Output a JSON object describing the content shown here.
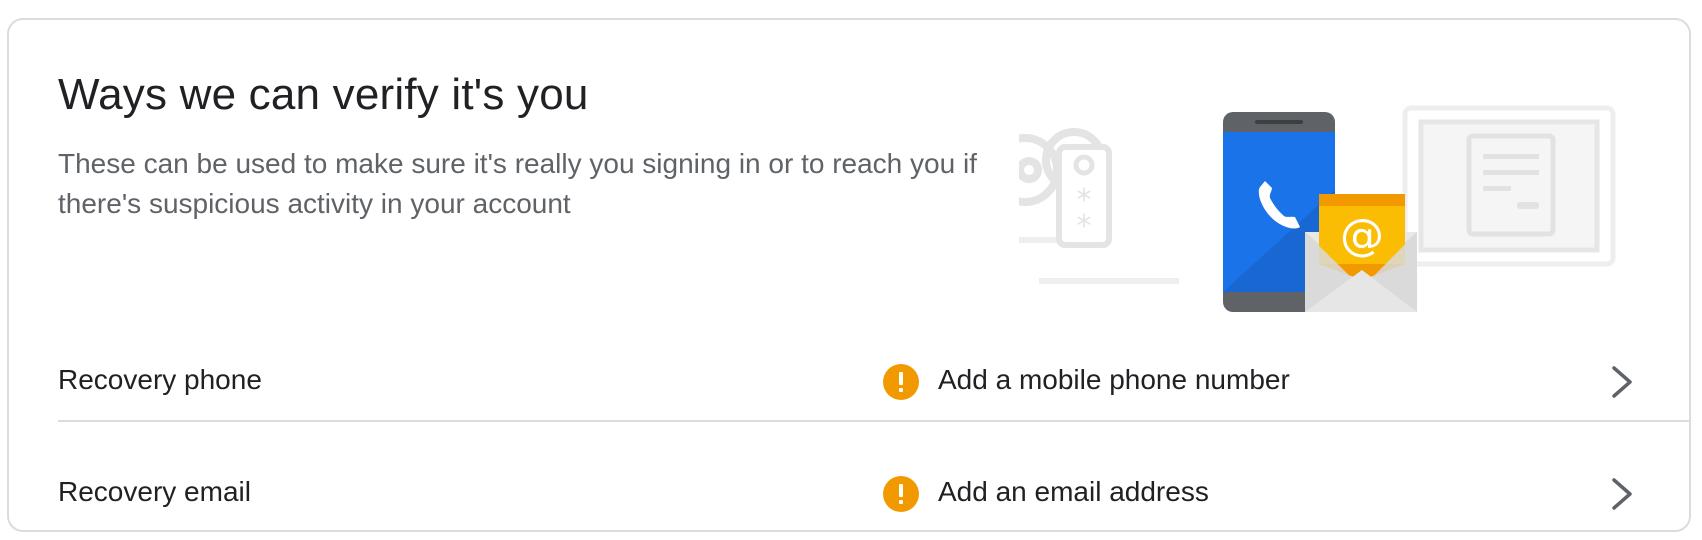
{
  "section": {
    "title": "Ways we can verify it's you",
    "subtitle": "These can be used to make sure it's really you signing in or to reach you if there's suspicious activity in your account"
  },
  "illustration": {
    "icon": "verification-methods-illustration"
  },
  "rows": [
    {
      "label": "Recovery phone",
      "status_icon": "warning-icon",
      "value": "Add a mobile phone number",
      "action_icon": "chevron-right-icon"
    },
    {
      "label": "Recovery email",
      "status_icon": "warning-icon",
      "value": "Add an email address",
      "action_icon": "chevron-right-icon"
    }
  ],
  "colors": {
    "warning": "#f29900",
    "phone_blue": "#1a73e8",
    "envelope_yellow": "#fbbc04",
    "divider": "#dadce0"
  }
}
